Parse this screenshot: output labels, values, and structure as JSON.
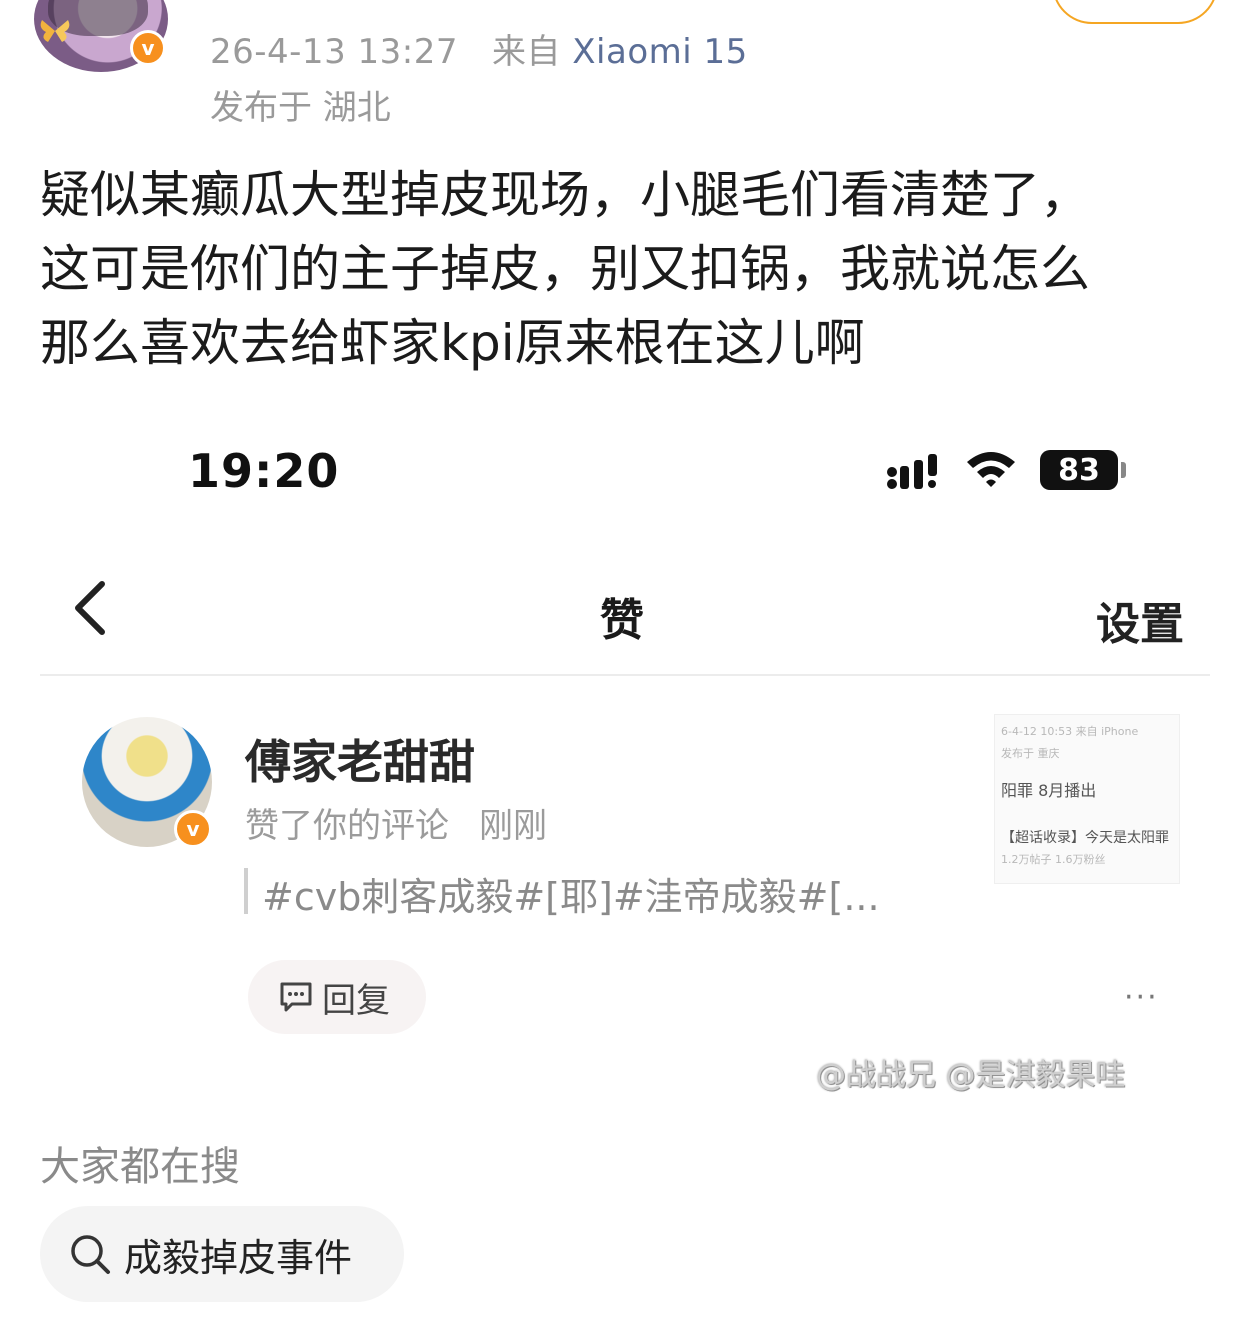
{
  "post": {
    "timestamp": "26-4-13 13:27",
    "source_prefix": "来自",
    "device": "Xiaomi 15",
    "location": "发布于 湖北",
    "badge": "v",
    "text_lines": [
      "疑似某癫瓜大型掉皮现场，小腿毛们看清楚了，",
      "这可是你们的主子掉皮，别又扣锅，我就说怎么",
      "那么喜欢去给虾家kpi原来根在这儿啊"
    ]
  },
  "embedded": {
    "status_bar": {
      "time": "19:20",
      "battery": "83"
    },
    "nav": {
      "title": "赞",
      "settings": "设置"
    },
    "like_item": {
      "name": "傅家老甜甜",
      "action": "赞了你的评论",
      "time": "刚刚",
      "quote": "#cvb刺客成毅#[耶]#洼帝成毅#[...",
      "badge": "v",
      "thumbnail": {
        "line1": "6-4-12 10:53  来自 iPhone",
        "line2": "发布于 重庆",
        "line3": "阳罪 8月播出",
        "line4": "【超话收录】今天是太阳罪",
        "line5": "1.2万帖子  1.6万粉丝"
      },
      "reply_label": "回复",
      "more": "···"
    },
    "watermark": "@战战兄 @是淇毅果哇"
  },
  "search": {
    "heading": "大家都在搜",
    "chip_label": "成毅掉皮事件"
  },
  "colors": {
    "accent_orange": "#f7901e",
    "device_blue": "#5b6e96",
    "meta_gray": "#9a9a9a"
  },
  "icons": [
    "butterfly-icon",
    "verified-icon",
    "signal-icon",
    "wifi-icon",
    "battery-icon",
    "back-icon",
    "comment-icon",
    "more-icon",
    "search-icon"
  ]
}
